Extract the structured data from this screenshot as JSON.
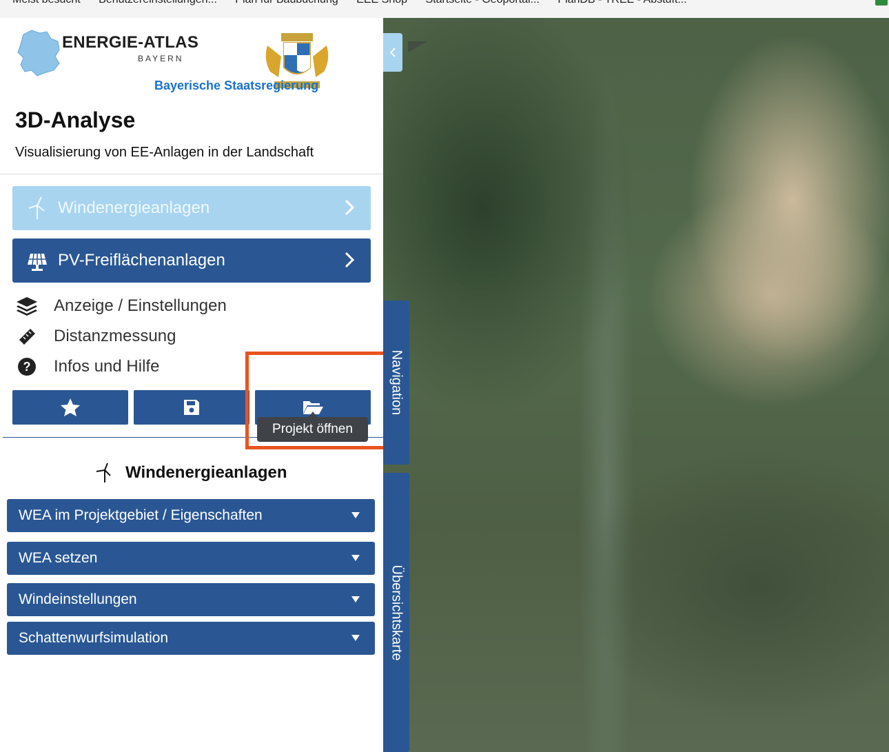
{
  "bookmarks": [
    "Meist besucht",
    "Benutzereinstellungen...",
    "Plan für Baubuchung",
    "EEE Shop",
    "Startseite - Geoportal...",
    "PlanDB - TREE - Abstuft..."
  ],
  "header": {
    "logo_title": "ENERGIE-ATLAS",
    "logo_subtitle": "BAYERN",
    "government": "Bayerische Staatsregierung"
  },
  "page": {
    "title": "3D-Analyse",
    "subtitle": "Visualisierung von EE-Anlagen in der Landschaft"
  },
  "nav_buttons": [
    {
      "label": "Windenergieanlagen",
      "icon": "wind-turbine-icon"
    },
    {
      "label": "PV-Freiflächenanlagen",
      "icon": "solar-panel-icon"
    }
  ],
  "menu": [
    {
      "label": "Anzeige / Einstellungen",
      "icon": "layers-icon"
    },
    {
      "label": "Distanzmessung",
      "icon": "ruler-icon"
    },
    {
      "label": "Infos und Hilfe",
      "icon": "question-circle-icon"
    }
  ],
  "toolbar": {
    "buttons": [
      {
        "icon": "star-icon"
      },
      {
        "icon": "save-icon"
      },
      {
        "icon": "folder-open-icon"
      }
    ],
    "tooltip": "Projekt öffnen"
  },
  "section": {
    "title": "Windenergieanlagen",
    "accordions": [
      "WEA im Projektgebiet / Eigenschaften",
      "WEA setzen",
      "Windeinstellungen",
      "Schattenwurfsimulation"
    ]
  },
  "map_tabs": {
    "navigation": "Navigation",
    "overview": "Übersichtskarte"
  },
  "colors": {
    "primary": "#2a5794",
    "active_light": "#a8d4f0",
    "highlight": "#e8541e",
    "tooltip_bg": "#3f4347"
  }
}
